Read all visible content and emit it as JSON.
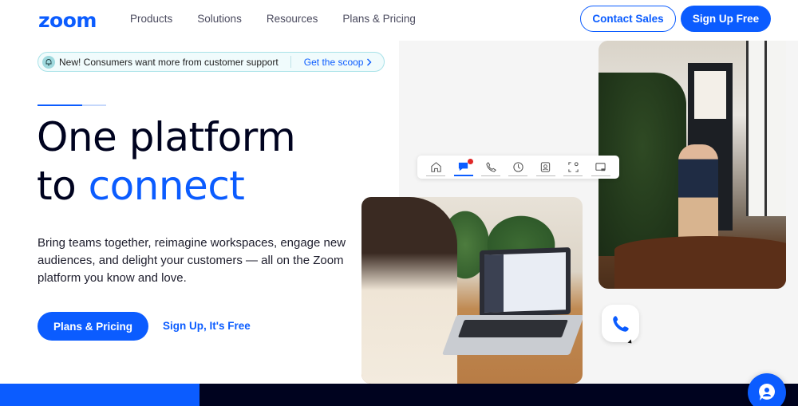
{
  "header": {
    "logo": "zoom",
    "nav": [
      "Products",
      "Solutions",
      "Resources",
      "Plans & Pricing"
    ],
    "contact_sales": "Contact Sales",
    "sign_up_free": "Sign Up Free"
  },
  "announcement": {
    "icon": "bell-icon",
    "text": "New! Consumers want more from customer support",
    "link": "Get the scoop"
  },
  "hero": {
    "headline_line1": "One platform",
    "headline_line2_prefix": "to ",
    "headline_line2_accent": "connect",
    "subtext": "Bring teams together, reimagine workspaces, engage new audiences, and delight your customers — all on the Zoom platform you know and love.",
    "primary_cta": "Plans & Pricing",
    "secondary_cta": "Sign Up, It's Free"
  },
  "toolbar": {
    "items": [
      {
        "icon": "home-icon",
        "active": false
      },
      {
        "icon": "chat-icon",
        "active": true,
        "badge": true
      },
      {
        "icon": "phone-icon",
        "active": false
      },
      {
        "icon": "clock-icon",
        "active": false
      },
      {
        "icon": "contacts-icon",
        "active": false
      },
      {
        "icon": "whiteboard-icon",
        "active": false
      },
      {
        "icon": "screen-share-icon",
        "active": false
      }
    ]
  },
  "colors": {
    "brand_blue": "#0b5cff",
    "dark_navy": "#00031f",
    "panel_gray": "#f5f5f5",
    "badge_red": "#e02828"
  }
}
